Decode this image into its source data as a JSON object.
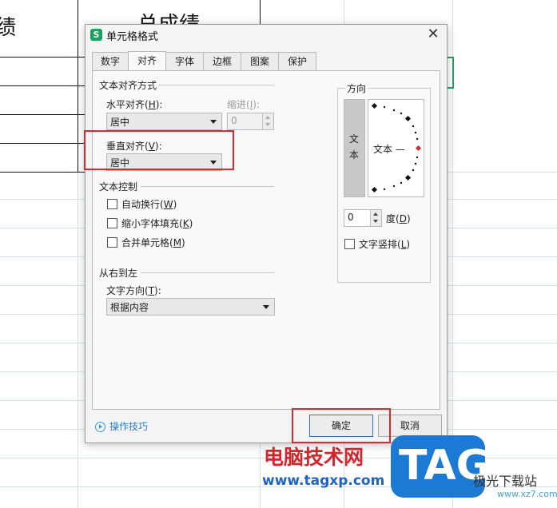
{
  "sheet": {
    "cell_left_partial": "绩",
    "cell_header_partial": "总成绩"
  },
  "dialog": {
    "title": "单元格格式",
    "app_icon": "S",
    "tabs": [
      "数字",
      "对齐",
      "字体",
      "边框",
      "图案",
      "保护"
    ],
    "active_tab": "对齐",
    "text_alignment": {
      "section": "文本对齐方式",
      "horizontal_label": "水平对齐(",
      "horizontal_key": "H",
      "horizontal_value": "居中",
      "indent_label": "缩进(",
      "indent_key": "I",
      "indent_value": "0",
      "vertical_label": "垂直对齐(",
      "vertical_key": "V",
      "vertical_value": "居中"
    },
    "text_control": {
      "section": "文本控制",
      "wrap_label": "自动换行(",
      "wrap_key": "W",
      "shrink_label": "缩小字体填充(",
      "shrink_key": "K",
      "merge_label": "合并单元格(",
      "merge_key": "M"
    },
    "rtl": {
      "section": "从右到左",
      "direction_label": "文字方向(",
      "direction_key": "T",
      "direction_value": "根据内容"
    },
    "orientation": {
      "section": "方向",
      "vertical_text": [
        "文",
        "本"
      ],
      "dial_text": "文本 —",
      "degrees_value": "0",
      "degrees_label": "度(",
      "degrees_key": "D",
      "vertical_stack_label": "文字竖排(",
      "vertical_stack_key": "L"
    },
    "tips_link": "操作技巧",
    "ok_label": "确定",
    "cancel_label": "取消"
  },
  "watermark": {
    "site_name": "电脑技术网",
    "url": "www.tagxp.com",
    "logo": "TAG",
    "small_text": "极光下载站",
    "small_url": "www.xz7.com"
  },
  "colors": {
    "highlight": "#e0272b",
    "selection": "#1fa463",
    "default_button": "#2f6ed3"
  }
}
